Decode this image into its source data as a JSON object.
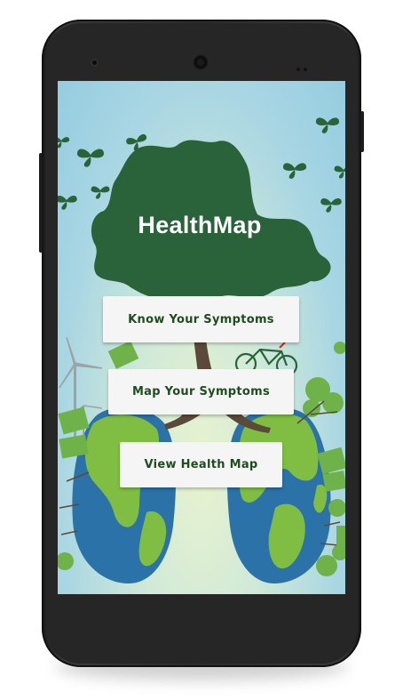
{
  "app": {
    "title": "HealthMap"
  },
  "menu": {
    "know_symptoms": "Know Your Symptoms",
    "map_symptoms": "Map Your Symptoms",
    "view_map": "View Health Map"
  },
  "colors": {
    "tree_green": "#2a6339",
    "button_text": "#1e4d1e",
    "ocean_blue": "#2a72a8",
    "land_green": "#7fbe43",
    "sky_blue": "#94cde0"
  },
  "icons": [
    "butterfly-icon",
    "wind-turbine-icon",
    "bicycle-icon",
    "solar-panel-icon",
    "tree-icon",
    "earth-lungs-icon",
    "building-icon"
  ]
}
